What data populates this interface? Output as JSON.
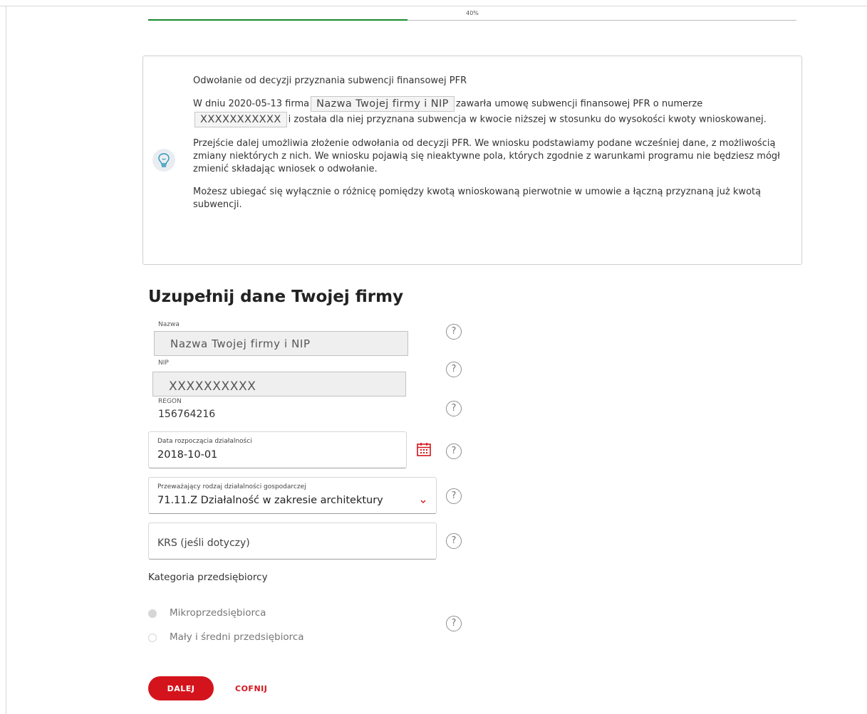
{
  "progress": {
    "label": "40%",
    "value": 0.4
  },
  "info": {
    "title": "Odwołanie od decyzji przyznania subwencji finansowej PFR",
    "p1_part1": "W dniu 2020-05-13 firma",
    "company_chip": "Nazwa Twojej firmy i NIP",
    "p1_part2": "zawarła umowę subwencji finansowej PFR o numerze",
    "contract_chip": "XXXXXXXXXXX",
    "p1_part3": "i została dla niej przyznana subwencja w kwocie niższej w stosunku do wysokości kwoty wnioskowanej.",
    "p2": "Przejście dalej umożliwia złożenie odwołania od decyzji PFR. We wniosku podstawiamy podane wcześniej dane, z możliwością zmiany niektórych z nich. We wniosku pojawią się nieaktywne pola, których zgodnie z warunkami programu nie będziesz mógł zmienić składając wniosek o odwołanie.",
    "p3": "Możesz ubiegać się wyłącznie o różnicę pomiędzy kwotą wnioskowaną pierwotnie w umowie a łączną przyznaną już kwotą subwencji."
  },
  "form": {
    "heading": "Uzupełnij dane Twojej firmy",
    "name_label": "Nazwa",
    "name_value": "Nazwa Twojej firmy i NIP",
    "nip_label": "NIP",
    "nip_value": "XXXXXXXXXX",
    "regon_label": "REGON",
    "regon_value": "156764216",
    "start_date_label": "Data rozpoczącia działalności",
    "start_date_value": "2018-10-01",
    "activity_label": "Przeważający rodzaj działalności gospodarczej",
    "activity_value": "71.11.Z Działalność w zakresie architektury",
    "krs_placeholder": "KRS (jeśli dotyczy)",
    "category_label": "Kategoria przedsiębiorcy",
    "category_options": [
      "Mikroprzedsiębiorca",
      "Mały i średni przedsiębiorca"
    ],
    "help_glyph": "?"
  },
  "buttons": {
    "next": "DALEJ",
    "back": "COFNIJ"
  },
  "colors": {
    "accent": "#d4141c",
    "progress": "#178a2f"
  }
}
